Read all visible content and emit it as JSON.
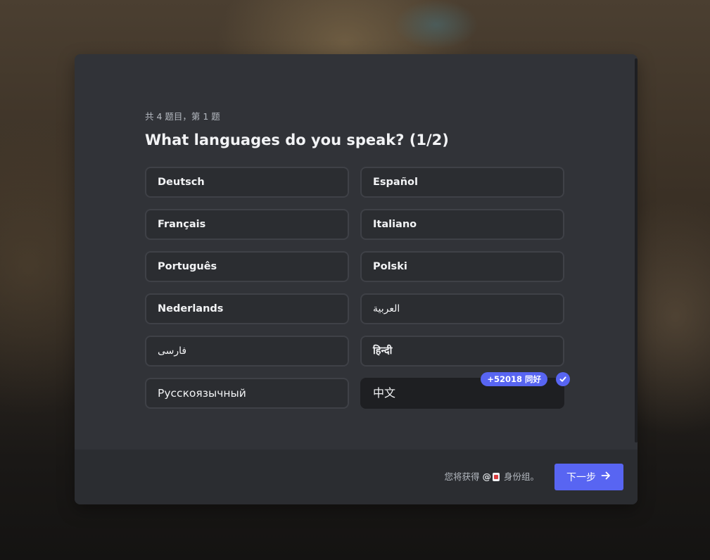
{
  "onboarding": {
    "progress_text": "共 4 题目，第 1 题",
    "question": "What languages do you speak? (1/2)",
    "options": [
      {
        "label": "Deutsch",
        "selected": false
      },
      {
        "label": "Español",
        "selected": false
      },
      {
        "label": "Français",
        "selected": false
      },
      {
        "label": "Italiano",
        "selected": false
      },
      {
        "label": "Português",
        "selected": false
      },
      {
        "label": "Polski",
        "selected": false
      },
      {
        "label": "Nederlands",
        "selected": false
      },
      {
        "label": "العربية",
        "selected": false
      },
      {
        "label": "فارسی",
        "selected": false
      },
      {
        "label": "हिन्दी",
        "selected": false
      },
      {
        "label": "Русскоязычный",
        "selected": false
      },
      {
        "label": "中文",
        "selected": true,
        "badge": "+52018 同好"
      }
    ]
  },
  "footer": {
    "note_prefix": "您将获得",
    "role_mention": "@",
    "note_suffix": "身份组。",
    "next_label": "下一步"
  },
  "colors": {
    "accent": "#5865f2",
    "modal_bg": "#313338",
    "option_bg": "#2b2d31",
    "selected_bg": "#1e1f22"
  }
}
